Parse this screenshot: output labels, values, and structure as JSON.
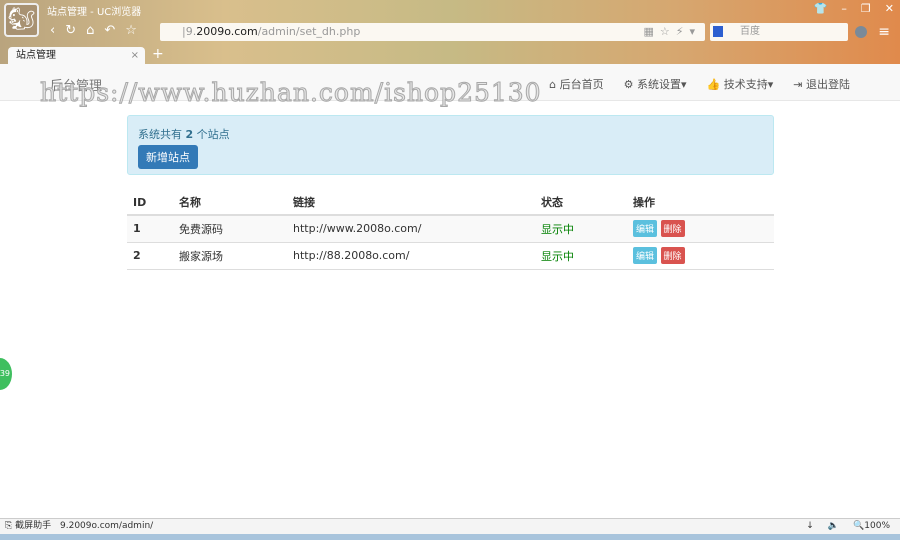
{
  "browser": {
    "window_title": "站点管理 - UC浏览器",
    "url_prefix": "|9.",
    "url_domain": "2009o.com",
    "url_path": "/admin/set_dh.php",
    "search_engine": "百度",
    "tab_label": "站点管理",
    "tab_close": "×",
    "new_tab": "+"
  },
  "navbar": {
    "brand": "后台管理",
    "links": [
      {
        "icon": "home-icon",
        "label": "后台首页"
      },
      {
        "icon": "gear-icon",
        "label": "系统设置▾"
      },
      {
        "icon": "thumbs-up-icon",
        "label": "技术支持▾"
      },
      {
        "icon": "logout-icon",
        "label": "退出登陆"
      }
    ]
  },
  "watermark": "https://www.huzhan.com/ishop25130",
  "alert": {
    "prefix": "系统共有 ",
    "count": "2",
    "suffix": " 个站点",
    "button": "新增站点"
  },
  "table": {
    "headers": [
      "ID",
      "名称",
      "链接",
      "状态",
      "操作"
    ],
    "rows": [
      {
        "id": "1",
        "name": "免费源码",
        "url": "http://www.2008o.com/",
        "status": "显示中",
        "edit": "编辑",
        "delete": "删除"
      },
      {
        "id": "2",
        "name": "搬家源场",
        "url": "http://88.2008o.com/",
        "status": "显示中",
        "edit": "编辑",
        "delete": "删除"
      }
    ]
  },
  "floating_badge": "39",
  "statusbar": {
    "helper": "截屏助手",
    "url": "9.2009o.com/admin/",
    "zoom": "100%"
  }
}
